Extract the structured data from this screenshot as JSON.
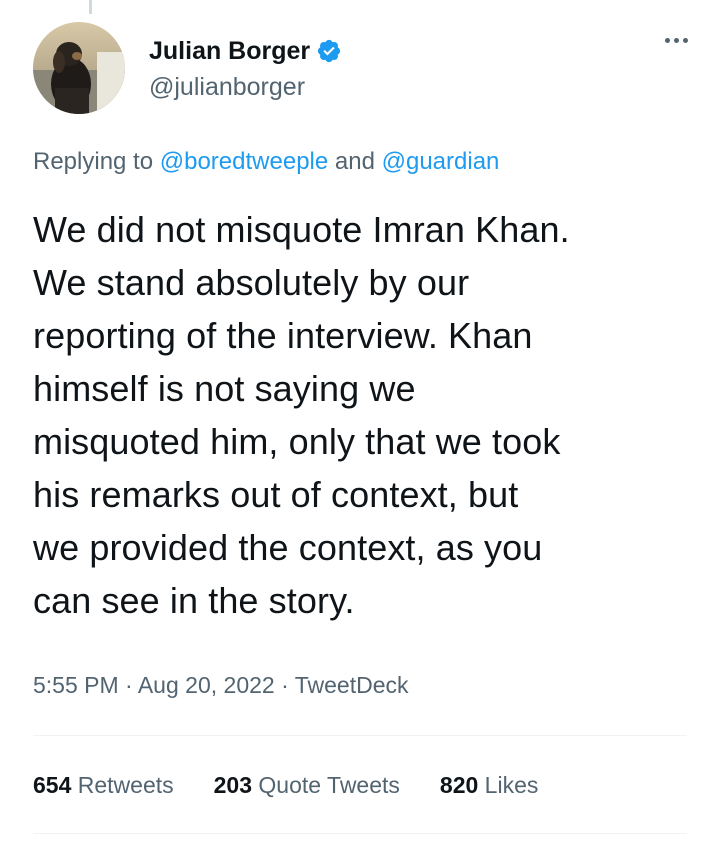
{
  "author": {
    "display_name": "Julian Borger",
    "handle": "@julianborger",
    "verified": true,
    "verified_color": "#1d9bf0"
  },
  "reply": {
    "prefix": "Replying to",
    "user1": "@boredtweeple",
    "joiner": "and",
    "user2": "@guardian"
  },
  "tweet": {
    "text": "We did not misquote Imran Khan.\nWe stand absolutely by our\nreporting of the interview. Khan\nhimself is not saying we\nmisquoted him, only that we took\nhis remarks out of context, but\nwe provided the context, as you\ncan see in the story."
  },
  "meta": {
    "time": "5:55 PM",
    "sep1": "·",
    "date": "Aug 20, 2022",
    "sep2": "·",
    "source": "TweetDeck"
  },
  "stats": {
    "retweets": {
      "count": "654",
      "label": "Retweets"
    },
    "quotes": {
      "count": "203",
      "label": "Quote Tweets"
    },
    "likes": {
      "count": "820",
      "label": "Likes"
    }
  },
  "icons": {
    "more": "more-horizontal-icon",
    "verified": "verified-badge-icon"
  },
  "colors": {
    "link": "#1d9bf0",
    "secondary_text": "#536471",
    "primary_text": "#0f1419"
  }
}
